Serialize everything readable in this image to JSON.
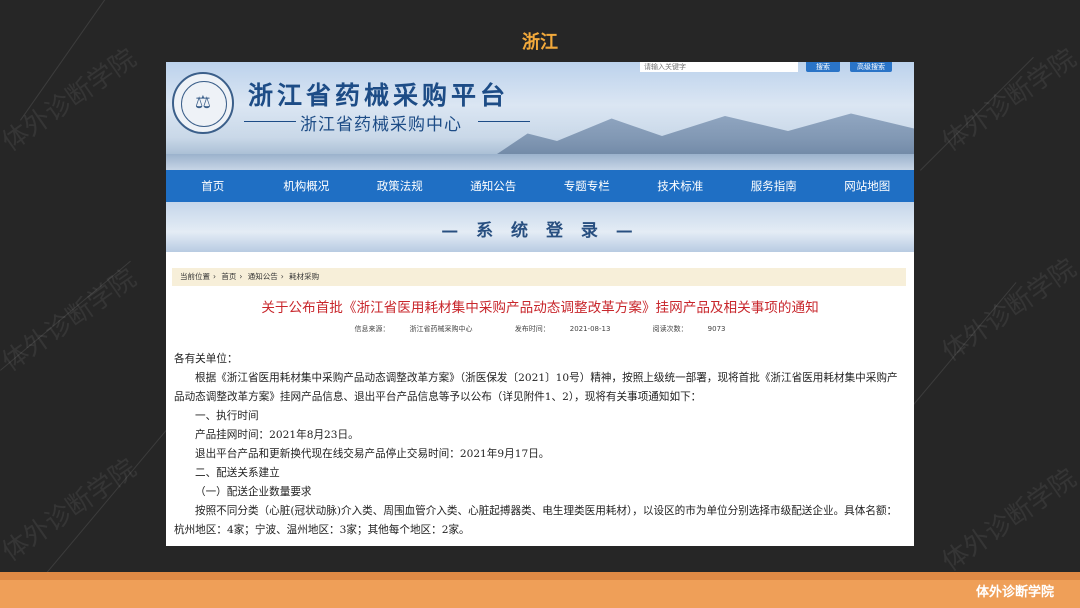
{
  "slide": {
    "title": "浙江",
    "footer_brand": "体外诊断学院",
    "watermark": "体外诊断学院"
  },
  "site": {
    "title": "浙江省药械采购平台",
    "subtitle": "浙江省药械采购中心",
    "search_placeholder": "请输入关键字",
    "search_button": "搜索",
    "advanced_search_button": "高级搜索"
  },
  "nav": {
    "items": [
      "首页",
      "机构概况",
      "政策法规",
      "通知公告",
      "专题专栏",
      "技术标准",
      "服务指南",
      "网站地图"
    ]
  },
  "login_banner": "— 系 统 登 录 —",
  "breadcrumb": {
    "label": "当前位置",
    "items": [
      "首页",
      "通知公告",
      "耗材采购"
    ]
  },
  "article": {
    "title": "关于公布首批《浙江省医用耗材集中采购产品动态调整改革方案》挂网产品及相关事项的通知",
    "source_label": "信息来源：",
    "source": "浙江省药械采购中心",
    "date_label": "发布时间：",
    "date": "2021-08-13",
    "views_label": "阅读次数：",
    "views": "9073",
    "salutation": "各有关单位：",
    "p1": "根据《浙江省医用耗材集中采购产品动态调整改革方案》（浙医保发〔2021〕10号）精神，按照上级统一部署，现将首批《浙江省医用耗材集中采购产品动态调整改革方案》挂网产品信息、退出平台产品信息等予以公布（详见附件1、2），现将有关事项通知如下：",
    "h1": "一、执行时间",
    "p2": "产品挂网时间：2021年8月23日。",
    "p3": "退出平台产品和更新换代现在线交易产品停止交易时间：2021年9月17日。",
    "h2": "二、配送关系建立",
    "h2_1": "（一）配送企业数量要求",
    "p4": "按照不同分类（心脏(冠状动脉)介入类、周围血管介入类、心脏起搏器类、电生理类医用耗材），以设区的市为单位分别选择市级配送企业。具体名额：杭州地区：4家；宁波、温州地区：3家；其他每个地区：2家。"
  }
}
